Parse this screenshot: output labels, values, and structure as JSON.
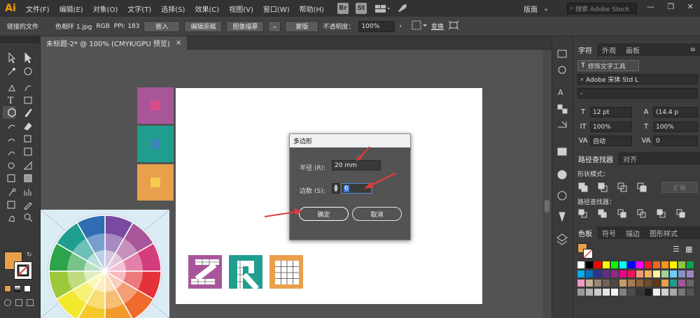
{
  "app": {
    "logo": "Ai"
  },
  "menu": [
    "文件(F)",
    "编辑(E)",
    "对象(O)",
    "文字(T)",
    "选择(S)",
    "效果(C)",
    "视图(V)",
    "窗口(W)",
    "帮助(H)"
  ],
  "menubar_buttons": {
    "br": "Br",
    "st": "St"
  },
  "workspace_label": "版面",
  "search_placeholder": "搜索 Adobe Stock",
  "control": {
    "linked_file": "链接的文件",
    "file_name": "色相环 1.jpg",
    "color_mode": "RGB",
    "ppi": "PPI: 183",
    "embed": "嵌入",
    "edit_original": "编辑原稿",
    "image_trace": "图像描摹",
    "mask": "蒙版",
    "opacity_label": "不透明度：",
    "opacity_value": "100%",
    "transform": "变换"
  },
  "document_tab": {
    "title": "未标题-2* @ 100% (CMYK/GPU 预览)",
    "close": "×"
  },
  "dialog": {
    "title": "多边形",
    "radius_label": "半径 (R):",
    "radius_value": "20 mm",
    "sides_label": "边数 (S):",
    "sides_value": "6",
    "ok": "确定",
    "cancel": "取消"
  },
  "panels": {
    "char_tabs": [
      "字符",
      "外观",
      "画板"
    ],
    "touch_type": "修饰文字工具",
    "font_family": "Adobe 宋体 Std L",
    "font_style": "-",
    "font_size": "12 pt",
    "leading": "(14.4 p",
    "vscale": "100%",
    "hscale": "100%",
    "kerning": "自动",
    "tracking": "0",
    "pathfinder_tabs": [
      "路径查找器",
      "对齐"
    ],
    "shape_modes": "形状模式：",
    "expand": "扩展",
    "pathfinders": "路径查找器：",
    "swatch_tabs": [
      "色板",
      "符号",
      "描边",
      "图形样式"
    ]
  },
  "colors": {
    "purple": "#a8569a",
    "teal": "#1f9e90",
    "orange": "#e8a04c",
    "arrow": "#e03a3a"
  }
}
